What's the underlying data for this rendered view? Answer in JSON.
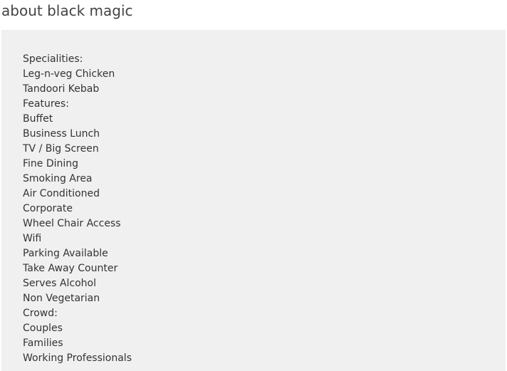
{
  "page": {
    "title": "about black magic"
  },
  "details": {
    "lines": [
      "Specialities:",
      "Leg-n-veg Chicken",
      "Tandoori Kebab",
      "Features:",
      "Buffet",
      "Business Lunch",
      "TV / Big Screen",
      "Fine Dining",
      "Smoking Area",
      "Air Conditioned",
      "Corporate",
      "Wheel Chair Access",
      "Wifi",
      "Parking Available",
      "Take Away Counter",
      "Serves Alcohol",
      "Non Vegetarian",
      "Crowd:",
      "Couples",
      "Families",
      "Working Professionals"
    ]
  },
  "colors": {
    "heading_text": "#444444",
    "body_text": "#333333",
    "panel_background": "#f0f0f0",
    "page_background": "#ffffff"
  }
}
